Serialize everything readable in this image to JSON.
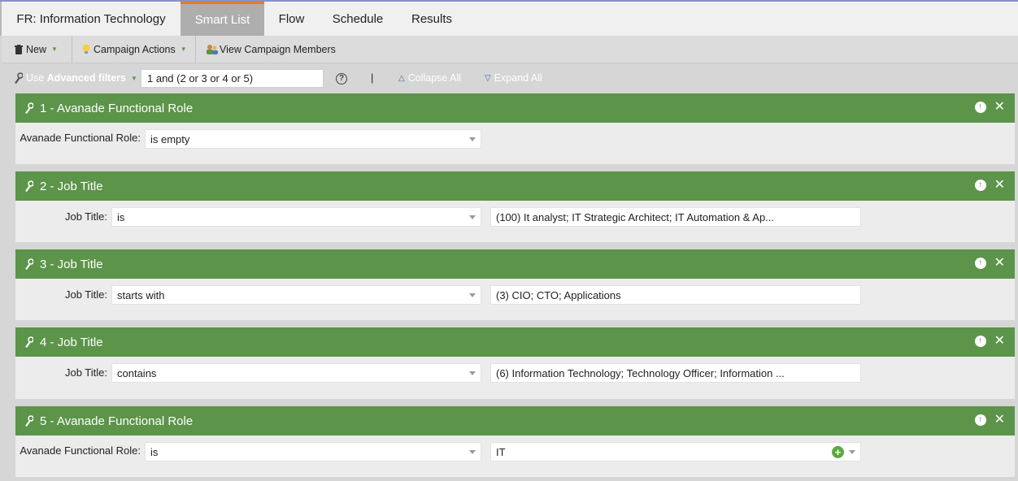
{
  "tabs": [
    {
      "label": "FR: Information Technology"
    },
    {
      "label": "Smart List"
    },
    {
      "label": "Flow"
    },
    {
      "label": "Schedule"
    },
    {
      "label": "Results"
    }
  ],
  "toolbar": {
    "new_label": "New",
    "campaign_actions_label": "Campaign Actions",
    "view_members_label": "View Campaign Members"
  },
  "filterbar": {
    "use_label": "Use",
    "advanced_label": "Advanced filters",
    "logic_value": "1 and (2 or 3 or 4 or 5)",
    "help_glyph": "?",
    "separator": "|",
    "collapse_label": "Collapse All",
    "expand_label": "Expand All"
  },
  "filters": [
    {
      "title": "1 - Avanade Functional Role",
      "label": "Avanade Functional Role:",
      "operator": "is empty",
      "value": ""
    },
    {
      "title": "2 - Job Title",
      "label": "Job Title:",
      "operator": "is",
      "value": "(100) It analyst; IT Strategic Architect; IT Automation & Ap..."
    },
    {
      "title": "3 - Job Title",
      "label": "Job Title:",
      "operator": "starts with",
      "value": "(3) CIO; CTO; Applications"
    },
    {
      "title": "4 - Job Title",
      "label": "Job Title:",
      "operator": "contains",
      "value": "(6) Information Technology; Technology Officer; Information ..."
    },
    {
      "title": "5 - Avanade Functional Role",
      "label": "Avanade Functional Role:",
      "operator": "is",
      "value": "IT"
    }
  ],
  "icons": {
    "new": "trash-can-icon",
    "campaign_actions": "lightbulb-icon",
    "view_members": "people-icon",
    "filter_handle": "wrench-icon",
    "move_up": "arrow-up-circle-icon",
    "remove": "close-icon",
    "add_value": "plus-circle-icon"
  },
  "colors": {
    "card_header": "#5c944a",
    "active_tab_border": "#e07b2f",
    "active_tab_bg": "#aeaeae"
  }
}
